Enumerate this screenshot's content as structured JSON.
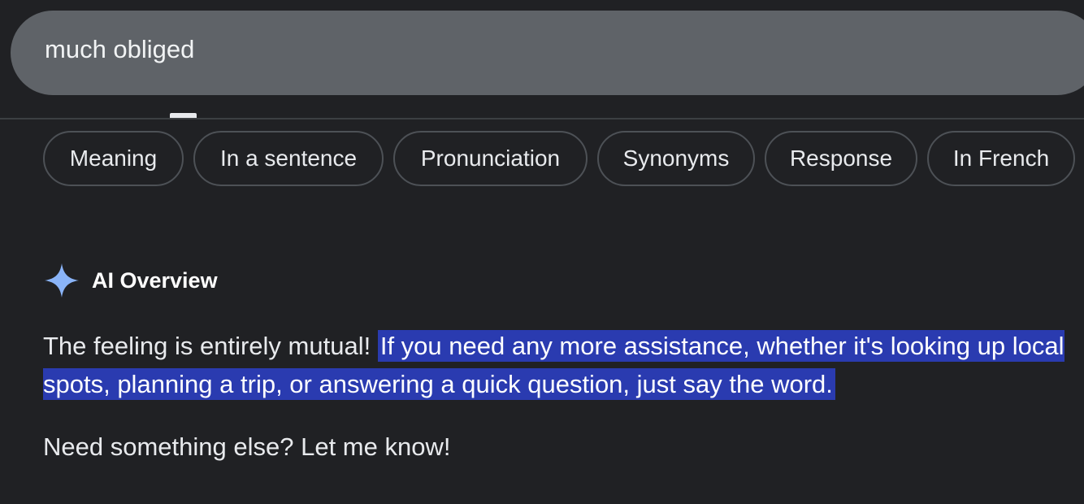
{
  "search": {
    "query": "much obliged"
  },
  "chips": [
    {
      "label": "Meaning"
    },
    {
      "label": "In a sentence"
    },
    {
      "label": "Pronunciation"
    },
    {
      "label": "Synonyms"
    },
    {
      "label": "Response"
    },
    {
      "label": "In French"
    }
  ],
  "ai_overview": {
    "icon": "sparkle-icon",
    "title": "AI Overview",
    "text_intro": "The feeling is entirely mutual!",
    "text_highlighted": "If you need any more assistance, whether it's looking up local spots, planning a trip, or answering a quick question, just say the word.",
    "follow_up": "Need something else? Let me know!"
  },
  "colors": {
    "background": "#202124",
    "search_bar": "#5f6368",
    "highlight": "#2a3bb0",
    "sparkle": "#8ab4f8"
  }
}
